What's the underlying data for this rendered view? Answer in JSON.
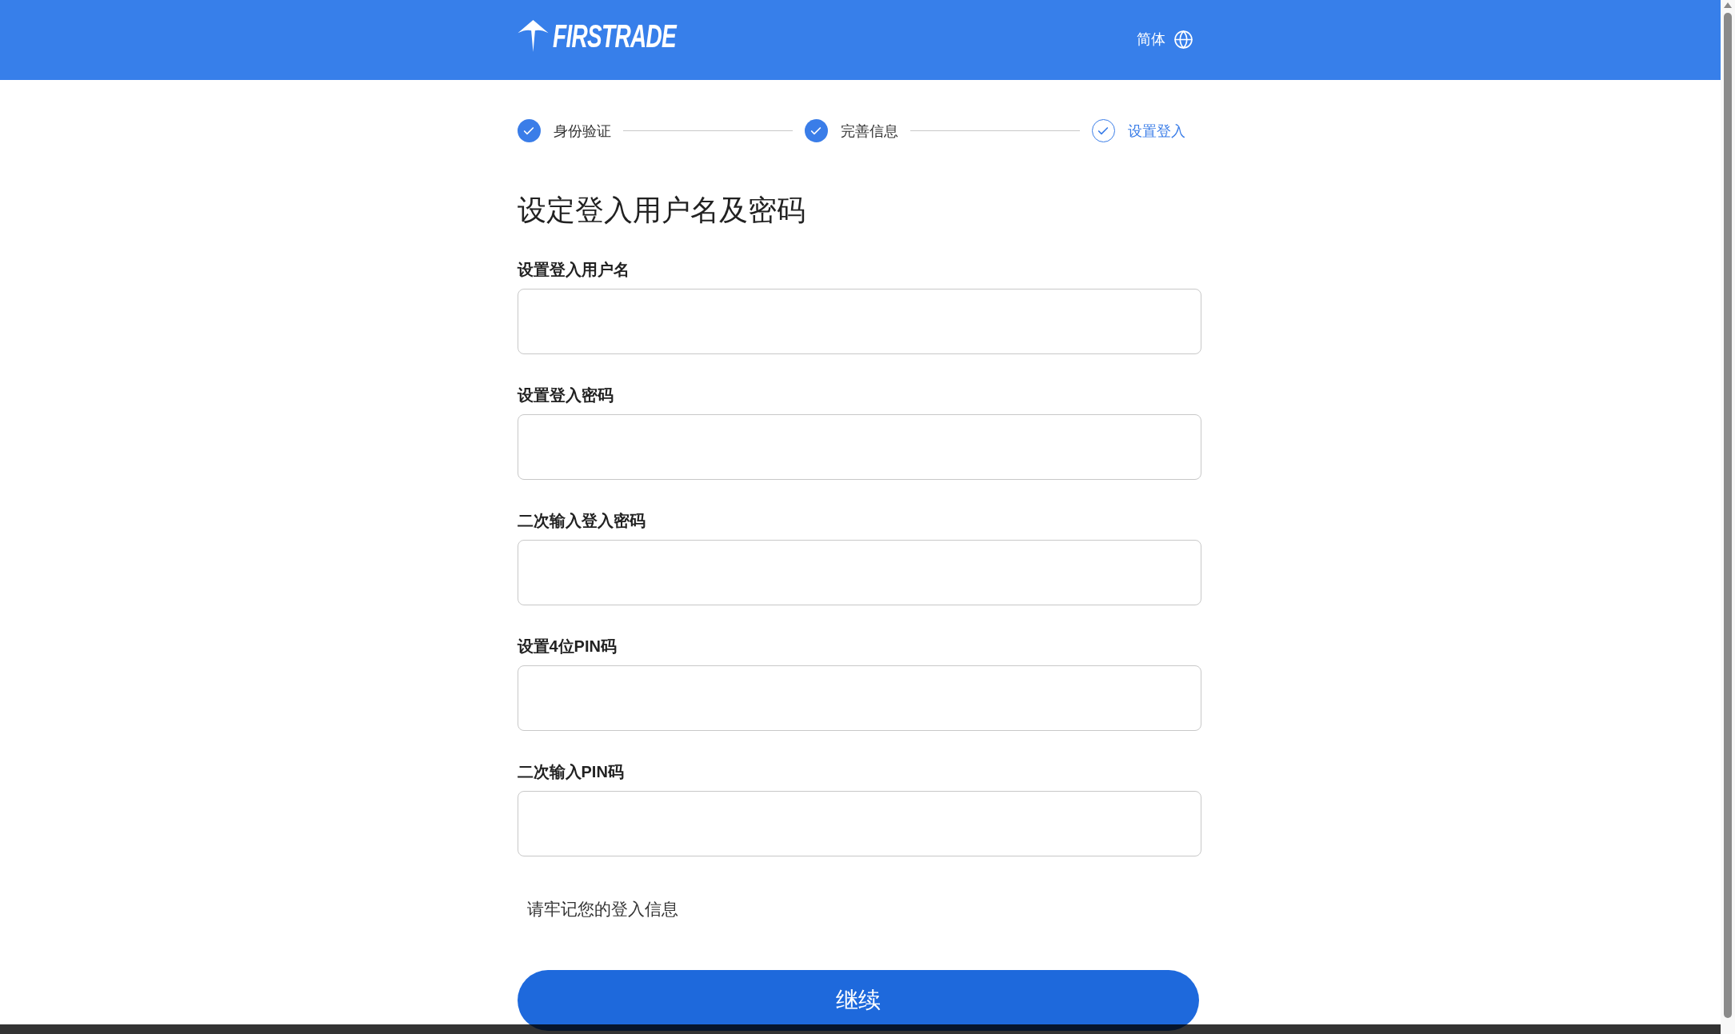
{
  "header": {
    "logo": {
      "text": "FIRSTRADE"
    },
    "language": {
      "label": "简体"
    }
  },
  "steps": [
    {
      "label": "身份验证",
      "completed": true,
      "current": false
    },
    {
      "label": "完善信息",
      "completed": true,
      "current": false
    },
    {
      "label": "设置登入",
      "completed": true,
      "current": true
    }
  ],
  "heading": "设定登入用户名及密码",
  "fields": [
    {
      "label": "设置登入用户名"
    },
    {
      "label": "设置登入密码"
    },
    {
      "label": "二次输入登入密码"
    },
    {
      "label": "设置4位PIN码"
    },
    {
      "label": "二次输入PIN码"
    }
  ],
  "note": "请牢记您的登入信息",
  "continue_button": {
    "label": "继续"
  }
}
